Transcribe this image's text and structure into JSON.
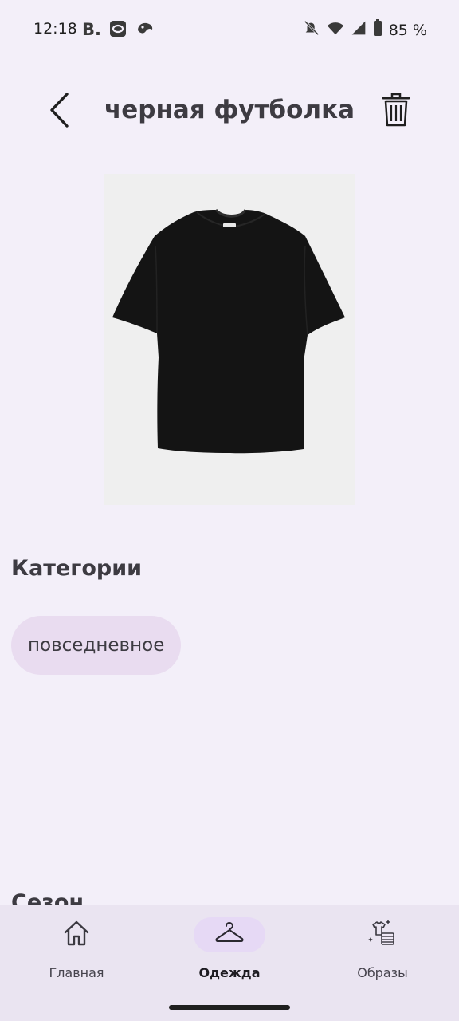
{
  "status_bar": {
    "time": "12:18",
    "battery_text": "85 %",
    "left_icons": [
      "vk-icon",
      "messenger-icon",
      "app-icon"
    ],
    "right_icons": [
      "mute-icon",
      "wifi-icon",
      "signal-icon",
      "battery-icon"
    ]
  },
  "header": {
    "title": "черная футболка",
    "back_icon": "chevron-left-icon",
    "delete_icon": "trash-icon"
  },
  "categories": {
    "title": "Категории",
    "chips": [
      "повседневное"
    ]
  },
  "season": {
    "title": "Сезон"
  },
  "bottom_nav": {
    "items": [
      {
        "label": "Главная",
        "icon": "home-icon",
        "active": false
      },
      {
        "label": "Одежда",
        "icon": "hanger-icon",
        "active": true
      },
      {
        "label": "Образы",
        "icon": "outfits-icon",
        "active": false
      }
    ]
  },
  "colors": {
    "background": "#f3eff9",
    "chip": "#e9dcf0",
    "nav_background": "#eae4f1",
    "nav_active": "#e6d9f5"
  }
}
